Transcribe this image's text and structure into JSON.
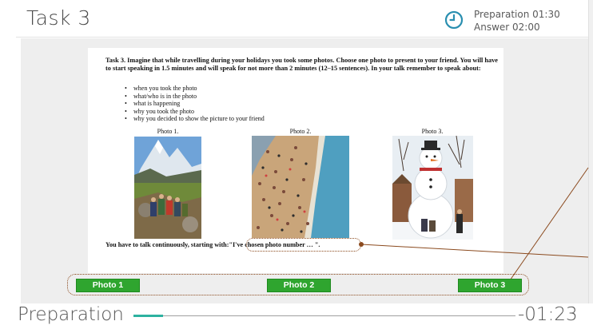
{
  "header": {
    "title": "Task 3",
    "timer_icon": "clock-icon",
    "preparation": "Preparation 01:30",
    "answer": "Answer 02:00"
  },
  "document": {
    "task_text": "Task 3. Imagine that while travelling during your holidays you took some photos. Choose one photo to present to your friend. You will have to start speaking in 1.5 minutes and will speak for not more than 2 minutes (12–15 sentences). In your talk remember to speak about:",
    "bullets": [
      "when you took the photo",
      "what/who is in the photo",
      "what is happening",
      "why you took the photo",
      "why you decided to show the picture to your friend"
    ],
    "photo_labels": [
      "Photo 1.",
      "Photo 2.",
      "Photo 3."
    ],
    "bottom_text": "You have to talk continuously, starting with:",
    "quote": "\"I've chosen photo number … \"."
  },
  "buttons": [
    "Photo 1",
    "Photo 2",
    "Photo 3"
  ],
  "footer": {
    "phase": "Preparation",
    "time_left": "-01:23",
    "progress": 0.078
  },
  "colors": {
    "accent": "#2db2a0",
    "button_green": "#2fa52f",
    "annotation_brown": "#8b4a1e"
  }
}
